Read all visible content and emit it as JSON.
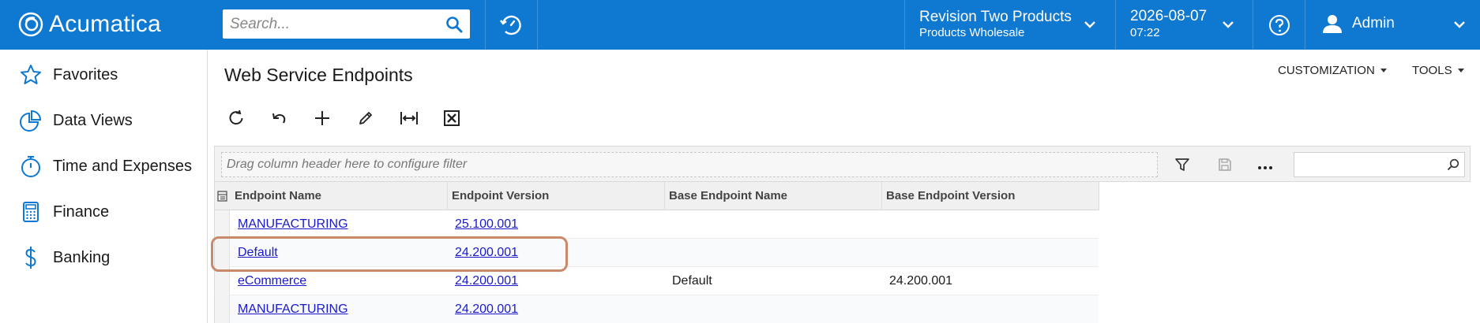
{
  "header": {
    "brand": "Acumatica",
    "search_placeholder": "Search...",
    "company_name": "Revision Two Products",
    "branch_name": "Products Wholesale",
    "date": "2026-08-07",
    "time": "07:22",
    "user_name": "Admin",
    "accent_color": "#0f78d0"
  },
  "sidebar": {
    "items": [
      {
        "label": "Favorites",
        "icon": "star-icon"
      },
      {
        "label": "Data Views",
        "icon": "pie-chart-icon"
      },
      {
        "label": "Time and Expenses",
        "icon": "stopwatch-icon"
      },
      {
        "label": "Finance",
        "icon": "calculator-icon"
      },
      {
        "label": "Banking",
        "icon": "dollar-icon"
      }
    ]
  },
  "page": {
    "title": "Web Service Endpoints",
    "customization_label": "CUSTOMIZATION",
    "tools_label": "TOOLS"
  },
  "toolbar": {
    "buttons": [
      "refresh-icon",
      "undo-icon",
      "add-icon",
      "edit-icon",
      "fit-columns-icon",
      "export-excel-icon"
    ]
  },
  "grid": {
    "filter_hint": "Drag column header here to configure filter",
    "columns": [
      "Endpoint Name",
      "Endpoint Version",
      "Base Endpoint Name",
      "Base Endpoint Version"
    ],
    "rows": [
      {
        "name": "MANUFACTURING",
        "version": "25.100.001",
        "base_name": "",
        "base_version": ""
      },
      {
        "name": "Default",
        "version": "24.200.001",
        "base_name": "",
        "base_version": ""
      },
      {
        "name": "eCommerce",
        "version": "24.200.001",
        "base_name": "Default",
        "base_version": "24.200.001"
      },
      {
        "name": "MANUFACTURING",
        "version": "24.200.001",
        "base_name": "",
        "base_version": ""
      }
    ]
  }
}
